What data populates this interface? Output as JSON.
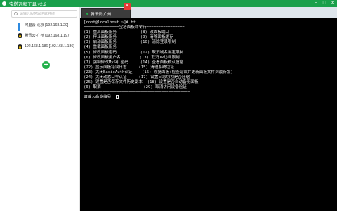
{
  "window": {
    "title": "宝塔远程工具 v2.2",
    "min": "−",
    "max": "□",
    "close": "✕"
  },
  "sidebar": {
    "search_placeholder": "请输入服务器IP或名称",
    "servers": [
      {
        "label": "阿里云-北京 [192.168.1.20]",
        "os": "windows-icon"
      },
      {
        "label": "腾讯云-广州 [192.168.1.197]",
        "os": "linux-icon"
      },
      {
        "label": "192.168.1.186 [192.168.1.186]",
        "os": "linux-icon"
      }
    ],
    "add_label": "+"
  },
  "tabs": [
    {
      "label": "腾讯云-广州",
      "close": "✕"
    }
  ],
  "terminal": {
    "lines": [
      "[root@localhost ~]# bt",
      "===============宝塔面板命令行================",
      "(1) 重启面板服务          (8) 改面板端口",
      "(2) 停止面板服务          (9) 清除面板缓存",
      "(3) 启动面板服务          (10) 清除登录限制",
      "(4) 重载面板服务",
      "(5) 修改面板密码          (12) 取消域名绑定限制",
      "(6) 修改面板用户名        (13) 取消IP访问限制",
      "(7) 强制修改MySQL密码     (14) 查看面板默认信息",
      "(22) 显示面板错误日志     (15) 清理系统垃圾",
      "(23) 关闭BasicAuth认证    (16) 修复面板(检查错误并更新面板文件到最新版)",
      "(24) 关闭动态口令认证     (17) 设置日志切割是否压缩",
      "(25) 设置是否保存文件历史副本  (18) 设置是否自动备份面板",
      "(0) 取消                  (29) 取消访问设备验证",
      "=============================================",
      "请输入命令编号："
    ]
  }
}
